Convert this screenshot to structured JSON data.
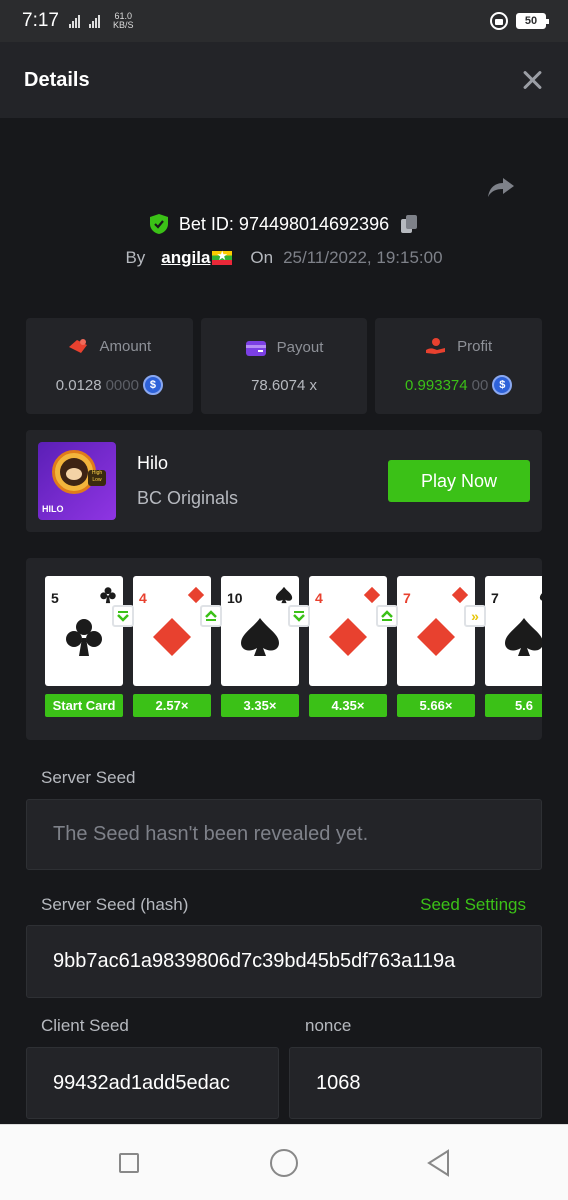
{
  "status_bar": {
    "time": "7:17",
    "network": "4G",
    "speed_value": "61.0",
    "speed_unit": "KB/S",
    "battery": "50"
  },
  "header": {
    "title": "Details"
  },
  "bet": {
    "id_label": "Bet ID: 974498014692396",
    "by_label": "By",
    "user": "angila",
    "on_label": "On",
    "date": "25/11/2022, 19:15:00"
  },
  "stats": {
    "amount": {
      "label": "Amount",
      "value_main": "0.0128",
      "value_dim": "0000",
      "icon": "amount-icon"
    },
    "payout": {
      "label": "Payout",
      "value": "78.6074 x",
      "icon": "wallet-icon"
    },
    "profit": {
      "label": "Profit",
      "value_main": "0.993374",
      "value_dim": "00",
      "icon": "profit-icon"
    }
  },
  "game": {
    "name": "Hilo",
    "provider": "BC Originals",
    "thumb_tag": "HILO",
    "thumb_mini": "High Low",
    "play_label": "Play Now"
  },
  "cards": [
    {
      "rank": "5",
      "suit": "clubs",
      "color": "#1b1b1b",
      "mult": "Start Card"
    },
    {
      "rank": "4",
      "suit": "diamonds",
      "color": "#e8412f",
      "mult": "2.57×"
    },
    {
      "rank": "10",
      "suit": "spades",
      "color": "#1b1b1b",
      "mult": "3.35×"
    },
    {
      "rank": "4",
      "suit": "diamonds",
      "color": "#e8412f",
      "mult": "4.35×"
    },
    {
      "rank": "7",
      "suit": "diamonds",
      "color": "#e8412f",
      "mult": "5.66×"
    },
    {
      "rank": "7",
      "suit": "spades",
      "color": "#1b1b1b",
      "mult": "5.6"
    }
  ],
  "arrows": [
    "down",
    "up",
    "down",
    "up",
    "skip"
  ],
  "fields": {
    "server_seed_label": "Server Seed",
    "server_seed_value": "The Seed hasn't been revealed yet.",
    "server_hash_label": "Server Seed (hash)",
    "seed_settings": "Seed Settings",
    "server_hash_value": "9bb7ac61a9839806d7c39bd45b5df763a119a",
    "client_seed_label": "Client Seed",
    "client_seed_value": "99432ad1add5edac",
    "nonce_label": "nonce",
    "nonce_value": "1068"
  },
  "colors": {
    "accent_green": "#3bc117",
    "panel": "#232428",
    "background": "#17181b"
  }
}
